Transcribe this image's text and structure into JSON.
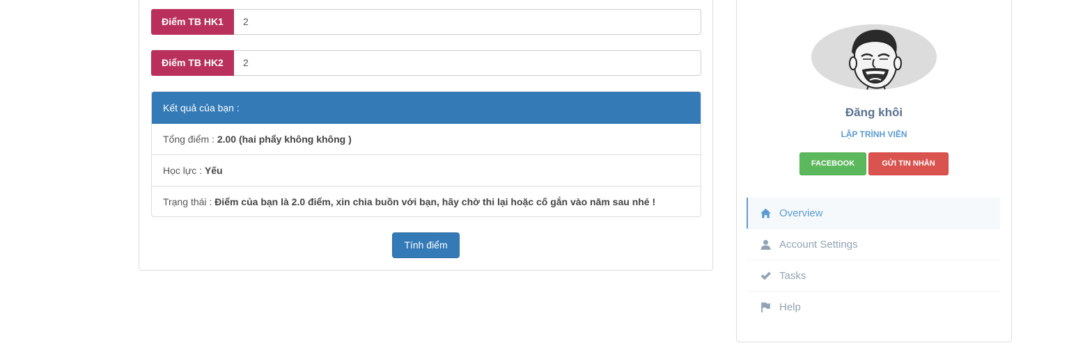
{
  "form": {
    "hk1": {
      "label": "Điểm TB HK1",
      "value": "2"
    },
    "hk2": {
      "label": "Điểm TB HK2",
      "value": "2"
    }
  },
  "result": {
    "heading": "Kết quả của bạn :",
    "total_label": "Tổng điểm : ",
    "total_value": "2.00 (hai phẩy không không )",
    "rank_label": "Học lực : ",
    "rank_value": "Yếu",
    "status_label": "Trạng thái : ",
    "status_value": "Điểm của bạn là 2.0 điểm, xin chia buồn với bạn, hãy chờ thi lại hoặc cố gắn vào năm sau nhé !"
  },
  "calc_button": "Tính điểm",
  "profile": {
    "name": "Đăng khôi",
    "role": "LẬP TRÌNH VIÊN",
    "facebook_button": "FACEBOOK",
    "message_button": "GỬI TIN NHẮN"
  },
  "menu": {
    "items": [
      {
        "label": "Overview",
        "icon": "home-icon",
        "active": true
      },
      {
        "label": "Account Settings",
        "icon": "user-icon",
        "active": false
      },
      {
        "label": "Tasks",
        "icon": "check-icon",
        "active": false
      },
      {
        "label": "Help",
        "icon": "flag-icon",
        "active": false
      }
    ]
  },
  "colors": {
    "addon": "#b9305c",
    "primary": "#337ab7",
    "success": "#5cb85c",
    "danger": "#d9534f",
    "menu_active": "#5b9bd1"
  }
}
